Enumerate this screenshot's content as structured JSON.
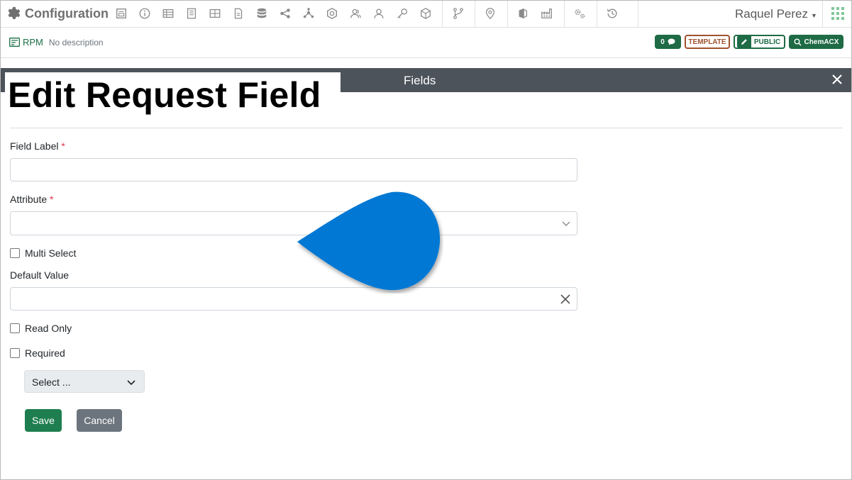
{
  "app": {
    "title": "Configuration",
    "user": "Raquel Perez"
  },
  "toolbar": {
    "icons": [
      "form-icon",
      "info-icon",
      "table-icon",
      "document-list-icon",
      "grid-icon",
      "file-icon",
      "database-icon",
      "share-icon",
      "network-icon",
      "badge-icon",
      "group-icon",
      "person-icon",
      "key-icon",
      "cube-icon",
      "workflow-icon",
      "location-icon",
      "shield-icon",
      "factory-icon",
      "settings-icon",
      "history-icon"
    ]
  },
  "subbar": {
    "record": "RPM",
    "description": "No description",
    "badges": {
      "count": "0",
      "template": "TEMPLATE",
      "public": "PUBLIC",
      "chemacx": "ChemACX"
    }
  },
  "modal": {
    "title": "Fields"
  },
  "overlay": {
    "heading": "Edit Request Field"
  },
  "form": {
    "field_label": {
      "label": "Field Label",
      "required_mark": "*",
      "value": ""
    },
    "attribute": {
      "label": "Attribute",
      "required_mark": "*",
      "value": ""
    },
    "multi_select": {
      "label": "Multi Select",
      "checked": false
    },
    "default_value": {
      "label": "Default Value",
      "value": ""
    },
    "read_only": {
      "label": "Read Only",
      "checked": false
    },
    "required": {
      "label": "Required",
      "checked": false
    },
    "select_placeholder": "Select ...",
    "save": "Save",
    "cancel": "Cancel"
  },
  "colors": {
    "brand_green": "#1e6b45",
    "template_brown": "#a0522d",
    "modal_header": "#4c535b",
    "drop_blue": "#0078d4"
  }
}
